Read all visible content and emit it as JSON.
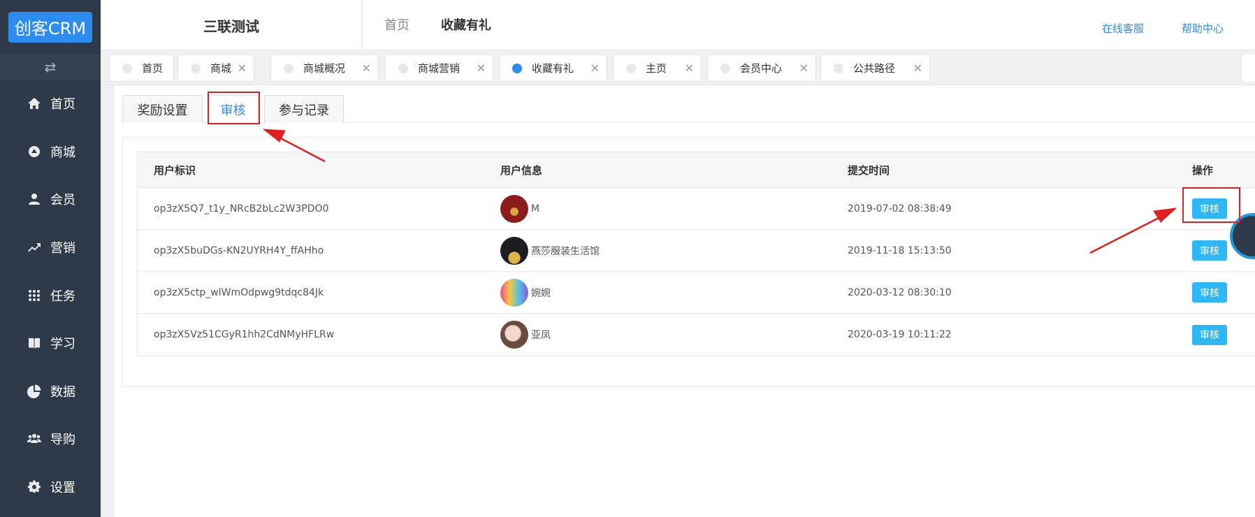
{
  "brand": {
    "logo_text": "创客CRM"
  },
  "sidebar": {
    "toggle_icon": "swap-arrows-icon",
    "items": [
      {
        "label": "首页",
        "icon": "home-icon"
      },
      {
        "label": "商城",
        "icon": "mall-icon"
      },
      {
        "label": "会员",
        "icon": "user-icon"
      },
      {
        "label": "营销",
        "icon": "trend-icon"
      },
      {
        "label": "任务",
        "icon": "grid-icon"
      },
      {
        "label": "学习",
        "icon": "book-icon"
      },
      {
        "label": "数据",
        "icon": "pie-icon"
      },
      {
        "label": "导购",
        "icon": "group-icon"
      },
      {
        "label": "设置",
        "icon": "gear-icon"
      }
    ]
  },
  "header": {
    "shop_name": "三联测试",
    "breadcrumb_home": "首页",
    "breadcrumb_current": "收藏有礼",
    "online_service": "在线客服",
    "help_center": "帮助中心"
  },
  "tabs": [
    {
      "label": "首页",
      "closable": false,
      "active": false
    },
    {
      "label": "商城",
      "closable": true,
      "active": false
    },
    {
      "label": "商城概况",
      "closable": true,
      "active": false
    },
    {
      "label": "商城营销",
      "closable": true,
      "active": false
    },
    {
      "label": "收藏有礼",
      "closable": true,
      "active": true
    },
    {
      "label": "主页",
      "closable": true,
      "active": false
    },
    {
      "label": "会员中心",
      "closable": true,
      "active": false
    },
    {
      "label": "公共路径",
      "closable": true,
      "active": false
    }
  ],
  "subtabs": {
    "reward": "奖励设置",
    "review": "审核",
    "records": "参与记录"
  },
  "table": {
    "headers": {
      "user_id": "用户标识",
      "user_info": "用户信息",
      "submit_time": "提交时间",
      "action": "操作"
    },
    "action_label": "审核",
    "rows": [
      {
        "user_id": "op3zX5Q7_t1y_NRcB2bLc2W3PDO0",
        "nickname": "M",
        "time": "2019-07-02 08:38:49"
      },
      {
        "user_id": "op3zX5buDGs-KN2UYRH4Y_ffAHho",
        "nickname": "燕莎服装生活馆",
        "time": "2019-11-18 15:13:50"
      },
      {
        "user_id": "op3zX5ctp_wlWmOdpwg9tdqc84Jk",
        "nickname": "婉婉",
        "time": "2020-03-12 08:30:10"
      },
      {
        "user_id": "op3zX5Vz51CGyR1hh2CdNMyHFLRw",
        "nickname": "亚凤",
        "time": "2020-03-19 10:11:22"
      }
    ]
  },
  "colors": {
    "sidebar": "#2f3a48",
    "primary": "#2d8cf0",
    "button": "#2db7f5",
    "annotation": "#e02020"
  }
}
